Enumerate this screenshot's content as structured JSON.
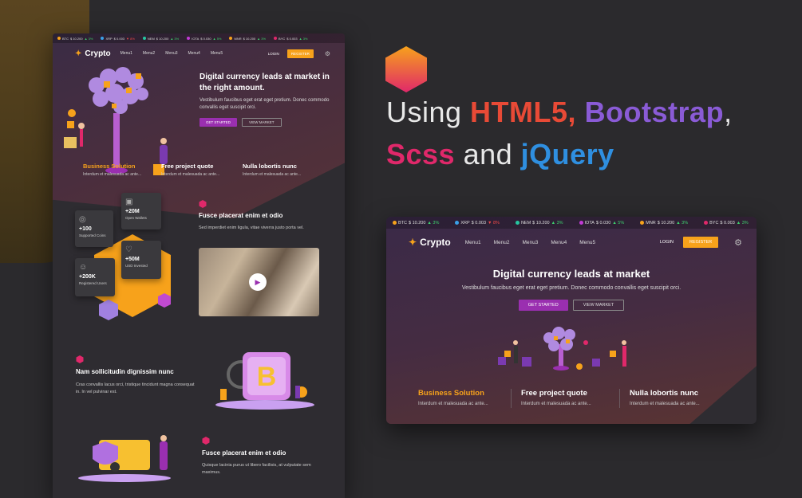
{
  "ticker": [
    {
      "symbol": "BTC",
      "price": "$ 10.200",
      "change": "▲ 3%",
      "dir": "up",
      "color": "#f7a21b"
    },
    {
      "symbol": "XRP",
      "price": "$ 0.003",
      "change": "▼ 8%",
      "dir": "down",
      "color": "#3aa0e8"
    },
    {
      "symbol": "NEM",
      "price": "$ 10.200",
      "change": "▲ 3%",
      "dir": "up",
      "color": "#26c6a0"
    },
    {
      "symbol": "IOTA",
      "price": "$ 0.030",
      "change": "▲ 5%",
      "dir": "up",
      "color": "#c23ad6"
    },
    {
      "symbol": "MNR",
      "price": "$ 10.200",
      "change": "▲ 3%",
      "dir": "up",
      "color": "#f7a21b"
    },
    {
      "symbol": "BYC",
      "price": "$ 0.003",
      "change": "▲ 3%",
      "dir": "up",
      "color": "#e0286a"
    }
  ],
  "brand": "Crypto",
  "menu": [
    "Menu1",
    "Menu2",
    "Menu3",
    "Menu4",
    "Menu5"
  ],
  "login": "LOGIN",
  "register": "REGISTER",
  "hero": {
    "title": "Digital currency leads at market in the right amount.",
    "title_short": "Digital currency leads at market",
    "desc": "Vestibulum faucibus eget erat eget pretium. Donec commodo convallis eget suscipit orci.",
    "cta_primary": "GET STARTED",
    "cta_secondary": "VIEW MARKET"
  },
  "features": [
    {
      "title": "Business Solution",
      "desc": "Interdum et malesuada ac ante..."
    },
    {
      "title": "Free project quote",
      "desc": "Interdum et malesuada ac ante..."
    },
    {
      "title": "Nulla lobortis nunc",
      "desc": "Interdum et malesuada ac ante..."
    }
  ],
  "stats": [
    {
      "value": "+100",
      "label": "Supported Coins"
    },
    {
      "value": "+20M",
      "label": "Open Wallets"
    },
    {
      "value": "+50M",
      "label": "USD Invested"
    },
    {
      "value": "+200K",
      "label": "Registered Users"
    }
  ],
  "sections": [
    {
      "title": "Fusce placerat enim et odio",
      "desc": "Sed imperdiet enim ligula, vitae viverra justo porta vel."
    },
    {
      "title": "Nam sollicitudin dignissim nunc",
      "desc": "Cras convallis lacus orci, tristique tincidunt magna consequat in. In vel pulvinar est."
    },
    {
      "title": "Fusce placerat enim et odio",
      "desc": "Quisque lacinia purus ut libero facilisis, at vulputate sem maximus."
    }
  ],
  "headline": {
    "using": "Using ",
    "html5": "HTML5,",
    "bootstrap": "Bootstrap",
    "comma": ",",
    "scss": "Scss",
    "and": " and ",
    "jquery": "jQuery"
  },
  "colors": {
    "orange": "#f7a21b",
    "purple": "#9a2fb0",
    "red": "#e84a36",
    "violet": "#8a5bd6",
    "pink": "#e0286a",
    "blue": "#2f8fe0"
  }
}
